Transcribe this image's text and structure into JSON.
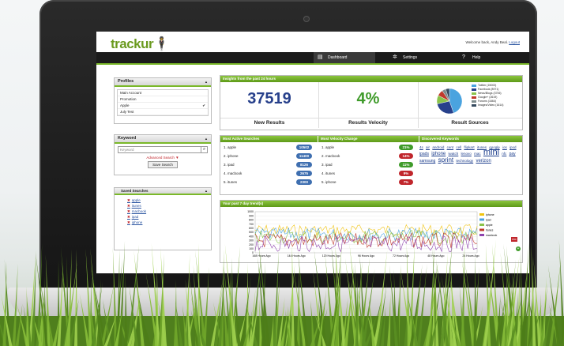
{
  "app": {
    "logo": "trackur",
    "welcome_prefix": "Welcome back, Andy Beal.",
    "logout": "Logout"
  },
  "nav": [
    {
      "label": "Dashboard",
      "icon": "dashboard-icon",
      "active": true
    },
    {
      "label": "Settings",
      "icon": "gear-icon",
      "active": false
    },
    {
      "label": "Help",
      "icon": "help-icon",
      "active": false
    }
  ],
  "profiles": {
    "title": "Profiles",
    "items": [
      "Main Account",
      "Promotion",
      "Apple",
      "July Test"
    ],
    "selected": "Apple"
  },
  "keyword": {
    "title": "Keyword",
    "placeholder": "Keyword",
    "advanced": "Advanced Search ▼",
    "button": "Save Search"
  },
  "saved": {
    "title": "Saved Searches",
    "items": [
      "apple",
      "itunes",
      "macbook",
      "ipad",
      "iphone"
    ]
  },
  "insights": {
    "title": "Insights from the past 24 hours",
    "new_results_value": "37519",
    "new_results_label": "New Results",
    "velocity_value": "4%",
    "velocity_label": "Results Velocity",
    "sources_label": "Result Sources",
    "sources_legend": [
      "Twitter (15003)",
      "Facebook (8971)",
      "News/Blogs (3706)",
      "Google+ (2619)",
      "Forums (1664)",
      "Images/Video (1614)"
    ],
    "sources_values": [
      15003,
      8971,
      3706,
      2619,
      1664,
      1614
    ],
    "sources_colors": [
      "#4aa3df",
      "#27408b",
      "#8bc34a",
      "#c0392b",
      "#7f8c8d",
      "#34495e"
    ]
  },
  "most_active": {
    "title": "Most Active Searches",
    "rows": [
      {
        "rank": "1. apple",
        "value": "10502"
      },
      {
        "rank": "2. iphone",
        "value": "11400"
      },
      {
        "rank": "3. ipad",
        "value": "8126"
      },
      {
        "rank": "4. macbook",
        "value": "2675"
      },
      {
        "rank": "5. itunes",
        "value": "2300"
      }
    ]
  },
  "velocity_change": {
    "title": "Most Velocity Change",
    "rows": [
      {
        "rank": "1. apple",
        "value": "21%",
        "color": "#3f9b2a"
      },
      {
        "rank": "2. macbook",
        "value": "14%",
        "color": "#c0262c"
      },
      {
        "rank": "3. ipad",
        "value": "11%",
        "color": "#3f9b2a"
      },
      {
        "rank": "4. itunes",
        "value": "9%",
        "color": "#c0262c"
      },
      {
        "rank": "5. iphone",
        "value": "7%",
        "color": "#c0262c"
      }
    ]
  },
  "discovered": {
    "title": "Discovered Keywords",
    "words": [
      "4s",
      "air",
      "android",
      "cent",
      "cell",
      "flipkart",
      "itunes",
      "google",
      "ios",
      "ipod",
      "ipads",
      "iphone",
      "iwatch",
      "lenovo",
      "mac",
      "mini",
      "nfc",
      "pay",
      "samsung",
      "sprint",
      "technology",
      "verizon"
    ]
  },
  "trend": {
    "title": "Your past 7 day trend(s)",
    "y_ticks": [
      "1000",
      "900",
      "800",
      "700",
      "600",
      "500",
      "400",
      "300",
      "200",
      "100",
      "0"
    ],
    "x_ticks": [
      "168 Hours Ago",
      "144 Hours Ago",
      "120 Hours Ago",
      "96 Hours Ago",
      "72 Hours Ago",
      "48 Hours Ago",
      "24 Hours Ago"
    ],
    "series": [
      {
        "name": "iphone",
        "color": "#f1c40f"
      },
      {
        "name": "ipad",
        "color": "#4aa3df"
      },
      {
        "name": "apple",
        "color": "#8bc34a"
      },
      {
        "name": "itunes",
        "color": "#c0392b"
      },
      {
        "name": "macbook",
        "color": "#8e44ad"
      }
    ]
  }
}
